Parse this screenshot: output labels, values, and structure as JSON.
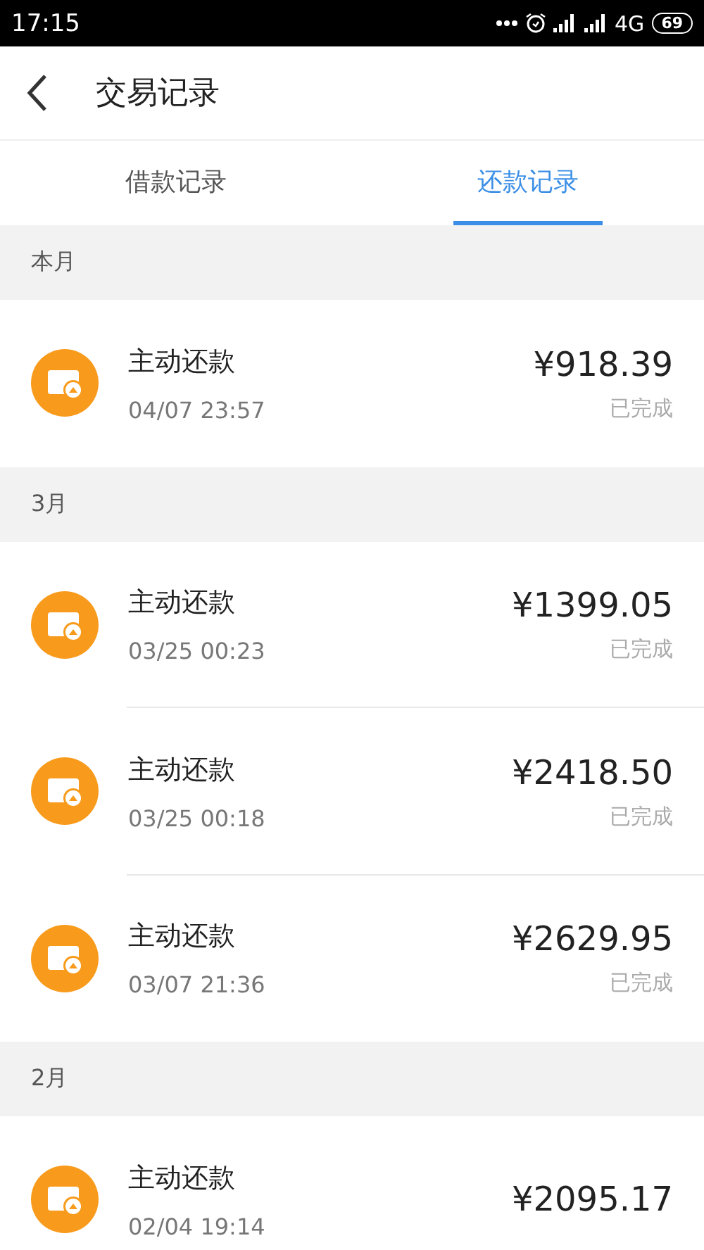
{
  "status_bar": {
    "time": "17:15",
    "network": "4G",
    "battery": "69"
  },
  "header": {
    "title": "交易记录"
  },
  "tabs": [
    {
      "label": "借款记录",
      "selected": false
    },
    {
      "label": "还款记录",
      "selected": true
    }
  ],
  "sections": [
    {
      "title": "本月",
      "items": [
        {
          "name": "主动还款",
          "time": "04/07 23:57",
          "amount": "¥918.39",
          "status": "已完成"
        }
      ]
    },
    {
      "title": "3月",
      "items": [
        {
          "name": "主动还款",
          "time": "03/25 00:23",
          "amount": "¥1399.05",
          "status": "已完成"
        },
        {
          "name": "主动还款",
          "time": "03/25 00:18",
          "amount": "¥2418.50",
          "status": "已完成"
        },
        {
          "name": "主动还款",
          "time": "03/07 21:36",
          "amount": "¥2629.95",
          "status": "已完成"
        }
      ]
    },
    {
      "title": "2月",
      "items": [
        {
          "name": "主动还款",
          "time": "02/04 19:14",
          "amount": "¥2095.17"
        }
      ]
    }
  ]
}
